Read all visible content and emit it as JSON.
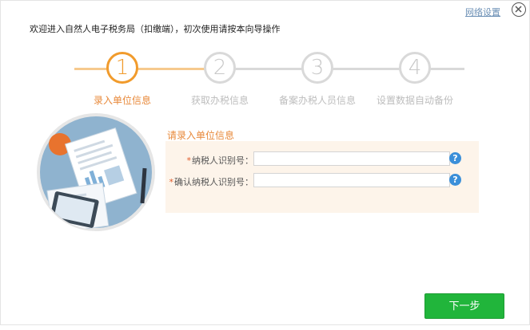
{
  "header": {
    "welcome_text": "欢迎进入自然人电子税务局（扣缴端），初次使用请按本向导操作",
    "network_settings_label": "网络设置"
  },
  "stepper": {
    "steps": [
      {
        "number": "1",
        "label": "录入单位信息",
        "active": true
      },
      {
        "number": "2",
        "label": "获取办税信息",
        "active": false
      },
      {
        "number": "3",
        "label": "备案办税人员信息",
        "active": false
      },
      {
        "number": "4",
        "label": "设置数据自动备份",
        "active": false
      }
    ]
  },
  "form": {
    "title": "请录入单位信息",
    "fields": [
      {
        "required_mark": "*",
        "label": "纳税人识别号：",
        "value": ""
      },
      {
        "required_mark": "*",
        "label": "确认纳税人识别号：",
        "value": ""
      }
    ],
    "help_glyph": "?"
  },
  "actions": {
    "next_label": "下一步"
  },
  "colors": {
    "accent_orange": "#f19b2c",
    "primary_green": "#21b53b",
    "help_blue": "#3b8fd9",
    "inactive_gray": "#d9d9d9"
  }
}
